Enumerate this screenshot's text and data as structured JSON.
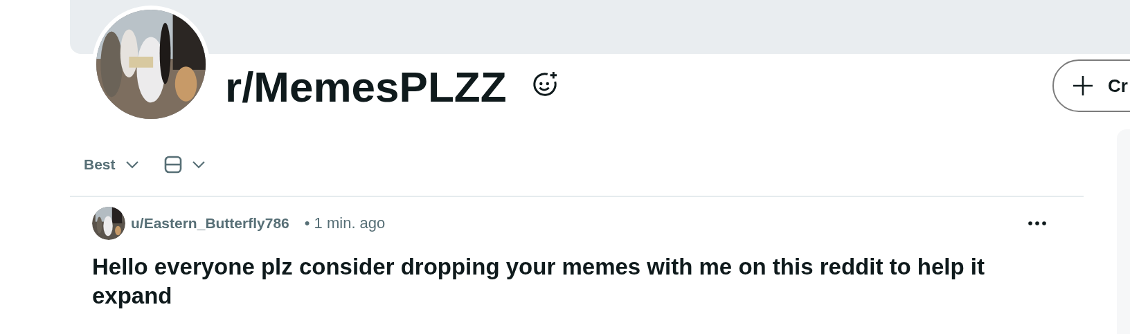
{
  "community": {
    "name": "r/MemesPLZZ"
  },
  "create_button": {
    "label": "Cr"
  },
  "sort": {
    "label": "Best"
  },
  "post": {
    "author": "u/Eastern_Butterfly786",
    "time": "• 1 min. ago",
    "title": "Hello everyone plz consider dropping your memes with me on this reddit to help it expand"
  }
}
